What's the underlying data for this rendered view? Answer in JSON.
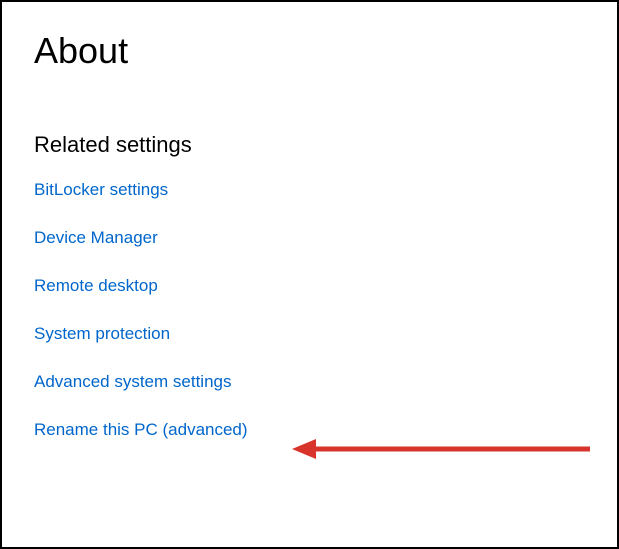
{
  "page": {
    "title": "About"
  },
  "related": {
    "heading": "Related settings",
    "links": [
      {
        "label": "BitLocker settings"
      },
      {
        "label": "Device Manager"
      },
      {
        "label": "Remote desktop"
      },
      {
        "label": "System protection"
      },
      {
        "label": "Advanced system settings"
      },
      {
        "label": "Rename this PC (advanced)"
      }
    ]
  },
  "annotation": {
    "color": "#d9342b"
  }
}
